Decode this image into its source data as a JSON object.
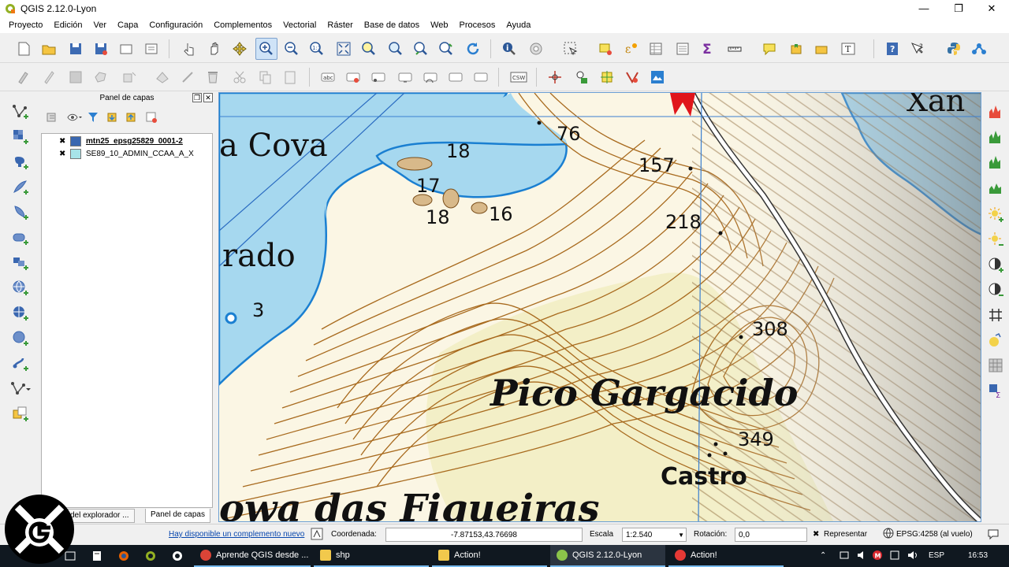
{
  "window": {
    "title": "QGIS 2.12.0-Lyon",
    "controls": {
      "minimize": "—",
      "restore": "❐",
      "close": "✕"
    }
  },
  "menu": [
    "Proyecto",
    "Edición",
    "Ver",
    "Capa",
    "Configuración",
    "Complementos",
    "Vectorial",
    "Ráster",
    "Base de datos",
    "Web",
    "Procesos",
    "Ayuda"
  ],
  "toolbar2_labels": {
    "abc": "abc",
    "csw": "CSW"
  },
  "layers_panel": {
    "title": "Panel de capas",
    "float_btn": "❐",
    "close_btn": "✕",
    "layers": [
      {
        "checked": "✖",
        "name": "mtn25_epsg25829_0001-2",
        "swatch": "#3a67b0"
      },
      {
        "checked": "✖",
        "name": "SE89_10_ADMIN_CCAA_A_X",
        "swatch": "#a7e3e8"
      }
    ],
    "tabs": [
      "del explorador ...",
      "Panel de capas"
    ]
  },
  "map": {
    "labels": {
      "cova": "a Cova",
      "rado": "rado",
      "pico": "Pico Gargacido",
      "castro": "Castro",
      "figueiras": "owa das Figueiras",
      "xan": "Xan"
    },
    "elevations": [
      "18",
      "17",
      "18",
      "16",
      "76",
      "157",
      "218",
      "3",
      "308",
      "349"
    ],
    "colors": {
      "sea": "#a6d8ef",
      "land": "#fbf6e4",
      "contour": "#a86a1e",
      "coast": "#1a7fd1",
      "grid": "#3b7fd0"
    }
  },
  "statusbar": {
    "plugin_link": "Hay disponible un complemento nuevo",
    "coord_label": "Coordenada:",
    "coord_value": "-7.87153,43.76698",
    "scale_label": "Escala",
    "scale_value": "1:2.540",
    "rotation_label": "Rotación:",
    "rotation_value": "0,0",
    "render_label": "Representar",
    "render_check": "✖",
    "crs": "EPSG:4258 (al vuelo)"
  },
  "taskbar": {
    "apps": [
      {
        "label": "Aprende QGIS desde ...",
        "color": "#db4437"
      },
      {
        "label": "shp",
        "color": "#f2c94c"
      },
      {
        "label": "Action!",
        "color": "#f2c94c"
      },
      {
        "label": "QGIS 2.12.0-Lyon",
        "color": "#8bc34a"
      },
      {
        "label": "Action!",
        "color": "#e53935"
      }
    ],
    "lang": "ESP",
    "time": "16:53"
  }
}
